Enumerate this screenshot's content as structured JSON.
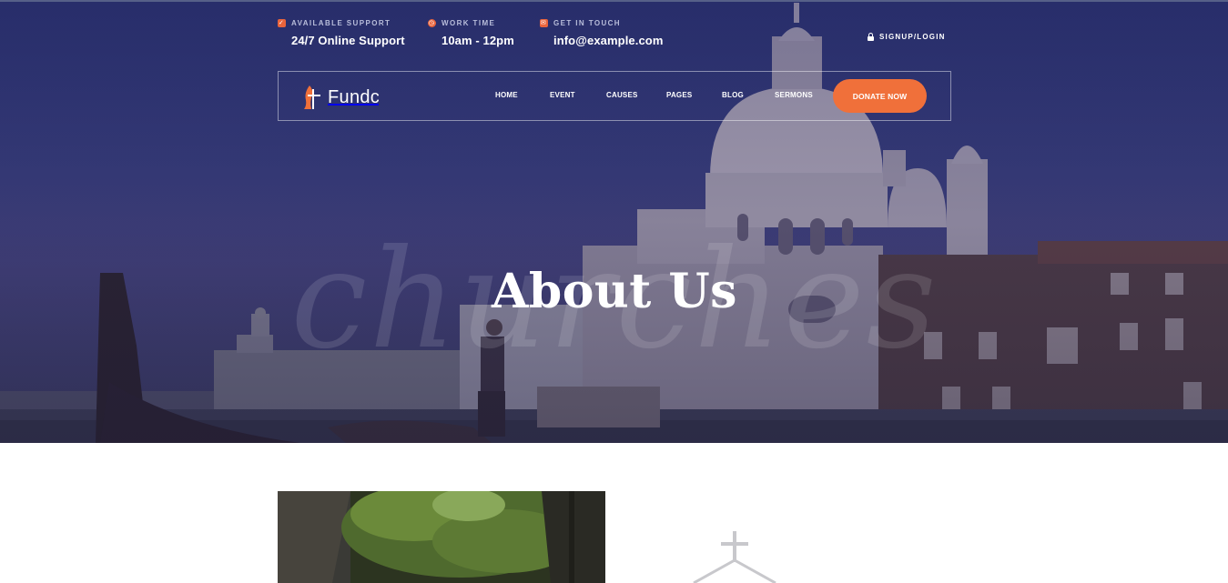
{
  "topbar": {
    "support": {
      "label": "AVAILABLE SUPPORT",
      "value": "24/7 Online Support",
      "icon": "check-square-icon"
    },
    "work_time": {
      "label": "WORK TIME",
      "value": "10am - 12pm",
      "icon": "clock-icon"
    },
    "contact": {
      "label": "GET IN TOUCH",
      "value": "info@example.com",
      "icon": "envelope-icon"
    },
    "signup_label": "SIGNUP/LOGIN"
  },
  "navbar": {
    "logo_text": "Fundc",
    "items": [
      "HOME",
      "EVENT",
      "CAUSES",
      "PAGES",
      "BLOG",
      "SERMONS"
    ],
    "donate_label": "DONATE NOW"
  },
  "hero": {
    "watermark": "churches",
    "title": "About Us"
  },
  "colors": {
    "accent": "#f0703a",
    "hero_tint": "#2f3574"
  }
}
